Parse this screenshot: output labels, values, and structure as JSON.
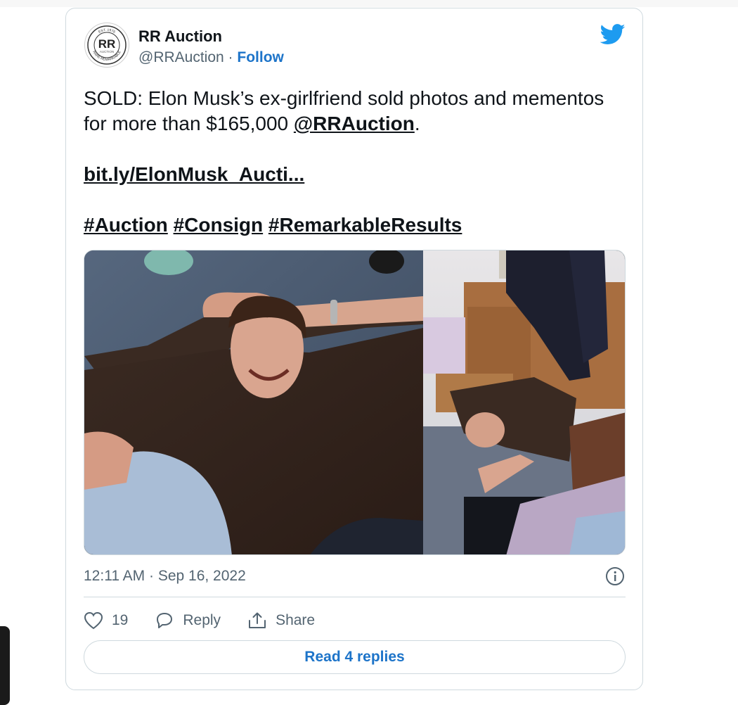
{
  "tweet": {
    "author": {
      "name": "RR Auction",
      "handle": "@RRAuction",
      "separator": "·",
      "follow_label": "Follow",
      "avatar": {
        "logo_text": "RR",
        "logo_subtext": "AUCTION",
        "ring_top": "EST. 1976",
        "ring_bottom": "RARE REMARKABLE"
      }
    },
    "text": {
      "line1": "SOLD: Elon Musk’s ex-girlfriend sold photos and mementos for more than $165,000 ",
      "mention": "@RRAuction",
      "line1_end": ".",
      "link": "bit.ly/ElonMusk_Aucti...",
      "hashtags": [
        "#Auction",
        "#Consign",
        "#RemarkableResults"
      ]
    },
    "timestamp": "12:11 AM · Sep 16, 2022",
    "actions": {
      "like_count": "19",
      "reply_label": "Reply",
      "share_label": "Share"
    },
    "read_replies_label": "Read 4 replies"
  },
  "icons": [
    "twitter-bird-icon",
    "info-icon",
    "heart-icon",
    "reply-icon",
    "share-icon"
  ],
  "colors": {
    "accent": "#1d74c9",
    "twitter_blue": "#1d9bf0",
    "secondary_text": "#536471",
    "border": "#cfd9de"
  }
}
